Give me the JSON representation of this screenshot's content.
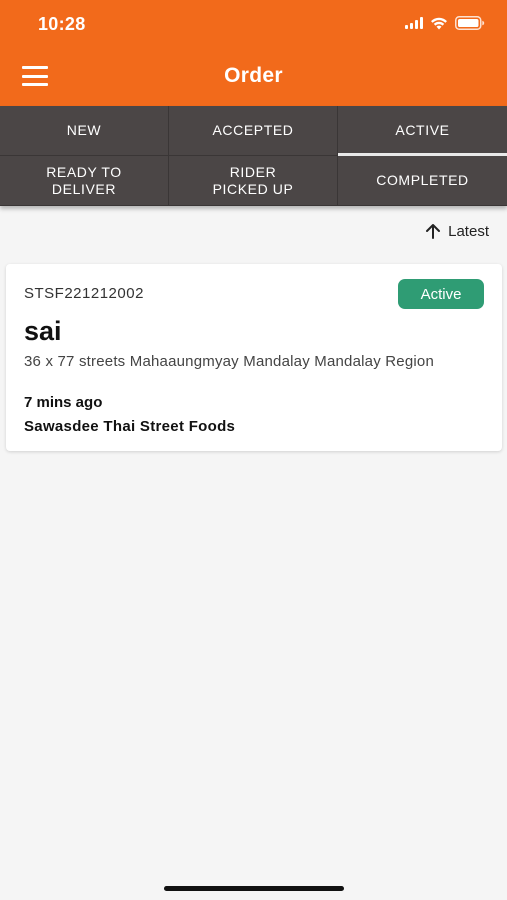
{
  "status_bar": {
    "time": "10:28"
  },
  "header": {
    "title": "Order"
  },
  "tabs": [
    {
      "label": "NEW"
    },
    {
      "label": "ACCEPTED"
    },
    {
      "label": "ACTIVE"
    },
    {
      "label": "READY TO\nDELIVER"
    },
    {
      "label": "RIDER\nPICKED UP"
    },
    {
      "label": "COMPLETED"
    }
  ],
  "active_tab": "ACTIVE",
  "sort": {
    "label": "Latest",
    "icon": "arrow-up-icon"
  },
  "orders": [
    {
      "order_id": "STSF221212002",
      "status": "Active",
      "customer": "sai",
      "address": "36 x 77 streets  Mahaaungmyay Mandalay Mandalay Region",
      "time_ago": "7 mins ago",
      "restaurant": "Sawasdee Thai Street Foods"
    }
  ],
  "colors": {
    "header": "#f26a1b",
    "tabs_bg": "#4b4646",
    "badge": "#2f9c74",
    "background": "#f5f5f5"
  },
  "icons": [
    "menu-icon",
    "signal-icon",
    "wifi-icon",
    "battery-icon",
    "arrow-up-icon"
  ]
}
